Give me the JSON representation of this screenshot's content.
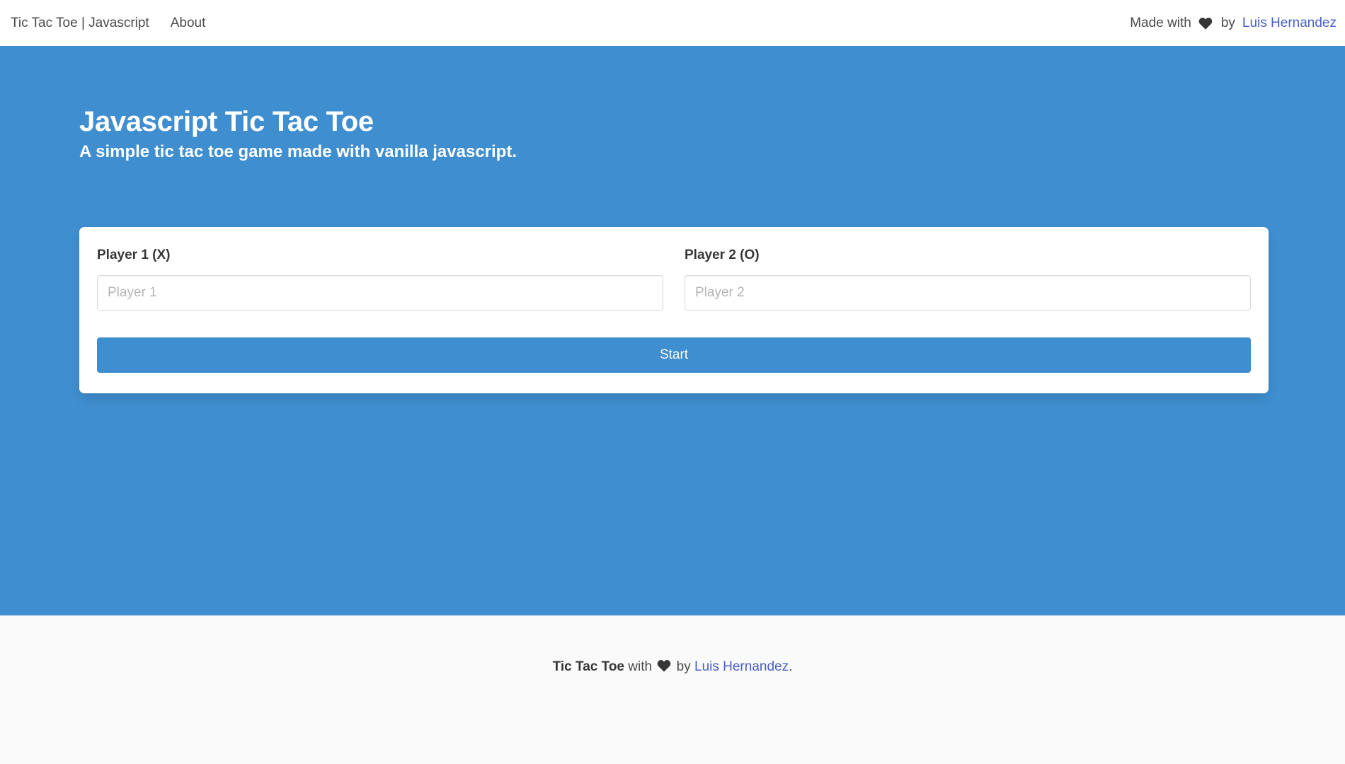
{
  "navbar": {
    "brand": "Tic Tac Toe | Javascript",
    "about": "About",
    "made_with": "Made with",
    "heart_icon": "heart-icon",
    "by": "by",
    "author": "Luis Hernandez"
  },
  "hero": {
    "title": "Javascript Tic Tac Toe",
    "subtitle": "A simple tic tac toe game made with vanilla javascript.",
    "background_color": "#3f8ed0"
  },
  "form": {
    "player1": {
      "label": "Player 1 (X)",
      "value": "",
      "placeholder": "Player 1"
    },
    "player2": {
      "label": "Player 2 (O)",
      "value": "",
      "placeholder": "Player 2"
    },
    "start_label": "Start",
    "button_color": "#3f8ed0"
  },
  "footer": {
    "app_name": "Tic Tac Toe",
    "with": "with",
    "by": "by",
    "author": "Luis Hernandez",
    "period": ".",
    "link_color": "#485fc7"
  }
}
